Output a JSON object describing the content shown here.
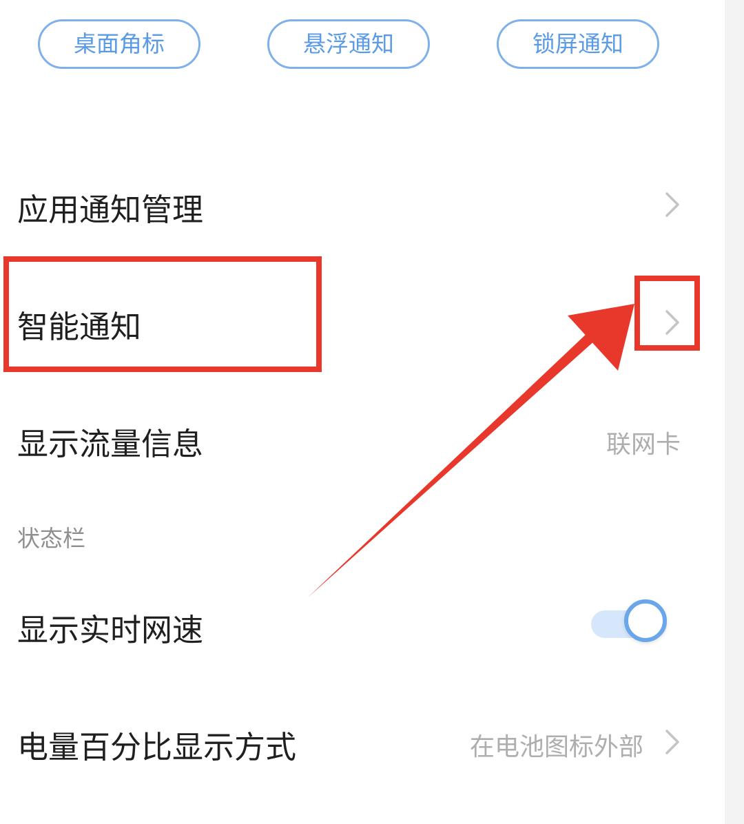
{
  "tabs": {
    "badge": "桌面角标",
    "floating": "悬浮通知",
    "lockscreen": "锁屏通知"
  },
  "rows": {
    "app_notification_management": "应用通知管理",
    "smart_notification": "智能通知",
    "show_data_usage": "显示流量信息",
    "show_data_usage_value": "联网卡",
    "status_bar_section": "状态栏",
    "show_realtime_speed": "显示实时网速",
    "battery_percentage_display": "电量百分比显示方式",
    "battery_percentage_value": "在电池图标外部"
  },
  "toggles": {
    "show_realtime_speed_on": true
  },
  "colors": {
    "accent": "#5b9be6",
    "annotation": "#e8372b",
    "text_primary": "#1f1f1f",
    "text_secondary": "#aeaeae"
  },
  "icons": {
    "chevron": "chevron-right-icon"
  }
}
